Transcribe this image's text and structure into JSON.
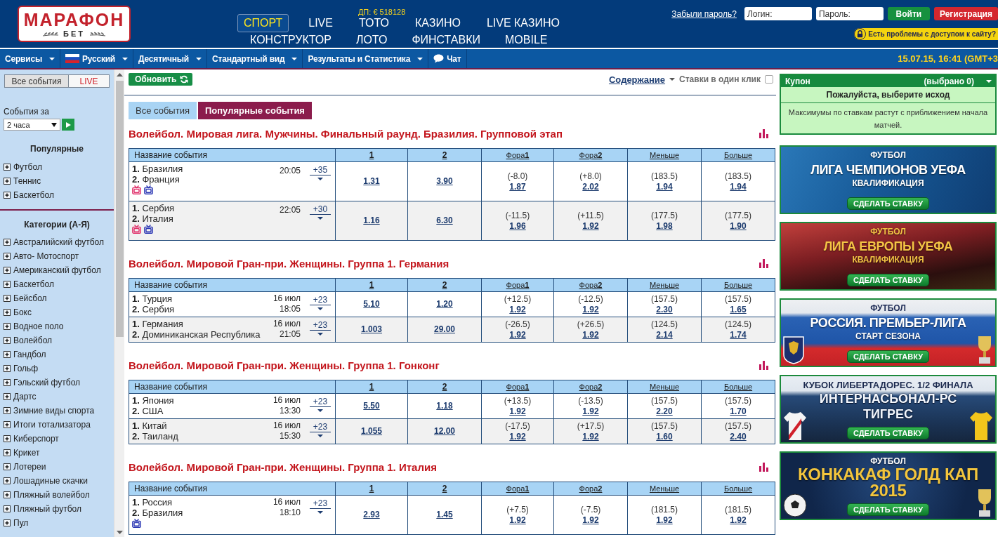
{
  "logo": {
    "title": "МАРАФОН",
    "subtitle": "БЕТ"
  },
  "nav": {
    "rows": [
      {
        "items": [
          {
            "label": "СПОРТ",
            "selected": true
          },
          {
            "label": "LIVE",
            "selected": false
          },
          {
            "label": "ТОТО",
            "selected": false,
            "badge": "ДП: € 518128"
          },
          {
            "label": "КАЗИНО",
            "selected": false
          },
          {
            "label": "LIVE КАЗИНО",
            "selected": false
          }
        ]
      },
      {
        "items": [
          {
            "label": "КОНСТРУКТОР",
            "selected": false
          },
          {
            "label": "ЛОТО",
            "selected": false
          },
          {
            "label": "ФИНСТАВКИ",
            "selected": false
          },
          {
            "label": "MOBILE",
            "selected": false
          }
        ]
      }
    ]
  },
  "account": {
    "forgot_link": "Забыли пароль?",
    "login_placeholder": "Логин:",
    "password_placeholder": "Пароль:",
    "login_button": "Войти",
    "register_button": "Регистрация",
    "access_notice": "Есть проблемы с доступом к сайту?"
  },
  "menu_bar": {
    "items": [
      {
        "label": "Сервисы",
        "kind": "dropdown"
      },
      {
        "label": "Русский",
        "kind": "language"
      },
      {
        "label": "Десятичный",
        "kind": "dropdown"
      },
      {
        "label": "Стандартный вид",
        "kind": "dropdown"
      },
      {
        "label": "Результаты и Статистика",
        "kind": "dropdown"
      },
      {
        "label": "Чат",
        "kind": "chat"
      }
    ],
    "datetime": "15.07.15, 16:41 (GMT+3"
  },
  "sidebar": {
    "tabs": [
      {
        "label": "Все события",
        "kind": "all",
        "selected": true
      },
      {
        "label": "LIVE",
        "kind": "live",
        "selected": false
      }
    ],
    "period": {
      "label": "События за",
      "value": "2 часа"
    },
    "popular": {
      "heading": "Популярные",
      "items": [
        {
          "label": "Футбол",
          "expanded": false
        },
        {
          "label": "Теннис",
          "expanded": false
        },
        {
          "label": "Баскетбол",
          "expanded": false
        }
      ]
    },
    "categories": {
      "heading": "Категории (А-Я)",
      "items": [
        {
          "label": "Австралийский футбол",
          "expanded": false
        },
        {
          "label": "Авто- Мотоспорт",
          "expanded": false
        },
        {
          "label": "Американский футбол",
          "expanded": false
        },
        {
          "label": "Баскетбол",
          "expanded": false
        },
        {
          "label": "Бейсбол",
          "expanded": false
        },
        {
          "label": "Бокс",
          "expanded": false
        },
        {
          "label": "Водное поло",
          "expanded": false
        },
        {
          "label": "Волейбол",
          "expanded": false
        },
        {
          "label": "Гандбол",
          "expanded": false
        },
        {
          "label": "Гольф",
          "expanded": false
        },
        {
          "label": "Гэльский футбол",
          "expanded": false
        },
        {
          "label": "Дартс",
          "expanded": false
        },
        {
          "label": "Зимние виды спорта",
          "expanded": false
        },
        {
          "label": "Итоги тотализатора",
          "expanded": false
        },
        {
          "label": "Киберспорт",
          "expanded": false
        },
        {
          "label": "Крикет",
          "expanded": false
        },
        {
          "label": "Лотереи",
          "expanded": false
        },
        {
          "label": "Лошадиные скачки",
          "expanded": false
        },
        {
          "label": "Пляжный волейбол",
          "expanded": false
        },
        {
          "label": "Пляжный футбол",
          "expanded": false
        },
        {
          "label": "Пул",
          "expanded": false
        }
      ]
    }
  },
  "content": {
    "refresh_button": "Обновить",
    "contents_link": "Содержание",
    "one_click": {
      "label": "Ставки в один клик",
      "checked": false
    },
    "tabs": [
      {
        "label": "Все события",
        "selected": false
      },
      {
        "label": "Популярные события",
        "selected": true
      }
    ],
    "sections": [
      {
        "title": "Волейбол. Мировая лига. Мужчины. Финальный раунд. Бразилия. Групповой этап",
        "columns": [
          {
            "label": "Название события",
            "kind": "name"
          },
          {
            "label": "1",
            "kind": "outcome"
          },
          {
            "label": "2",
            "kind": "outcome"
          },
          {
            "label": "Фора**1**",
            "kind": "market"
          },
          {
            "label": "Фора**2**",
            "kind": "market"
          },
          {
            "label": "Меньше",
            "kind": "market"
          },
          {
            "label": "Больше",
            "kind": "market"
          }
        ],
        "rows": [
          {
            "teams": [
              "**1.** Бразилия",
              "**2.** Франция"
            ],
            "time": "20:05",
            "more": "+35",
            "tv": [
              {
                "color": "#e0306a"
              },
              {
                "color": "#2b37b4"
              }
            ],
            "odds": [
              {
                "price": "1.31"
              },
              {
                "price": "3.90"
              },
              {
                "line": "(-8.0)",
                "price": "1.87"
              },
              {
                "line": "(+8.0)",
                "price": "2.02"
              },
              {
                "line": "(183.5)",
                "price": "1.94"
              },
              {
                "line": "(183.5)",
                "price": "1.94"
              }
            ]
          },
          {
            "teams": [
              "**1.** Сербия",
              "**2.** Италия"
            ],
            "time": "22:05",
            "more": "+30",
            "tv": [
              {
                "color": "#e0306a"
              },
              {
                "color": "#2b37b4"
              }
            ],
            "odds": [
              {
                "price": "1.16"
              },
              {
                "price": "6.30"
              },
              {
                "line": "(-11.5)",
                "price": "1.96"
              },
              {
                "line": "(+11.5)",
                "price": "1.92"
              },
              {
                "line": "(177.5)",
                "price": "1.98"
              },
              {
                "line": "(177.5)",
                "price": "1.90"
              }
            ]
          }
        ]
      },
      {
        "title": "Волейбол. Мировой Гран-при. Женщины. Группа 1. Германия",
        "columns": [
          {
            "label": "Название события",
            "kind": "name"
          },
          {
            "label": "1",
            "kind": "outcome"
          },
          {
            "label": "2",
            "kind": "outcome"
          },
          {
            "label": "Фора**1**",
            "kind": "market"
          },
          {
            "label": "Фора**2**",
            "kind": "market"
          },
          {
            "label": "Меньше",
            "kind": "market"
          },
          {
            "label": "Больше",
            "kind": "market"
          }
        ],
        "rows": [
          {
            "teams": [
              "**1.** Турция",
              "**2.** Сербия"
            ],
            "date": "16 июл",
            "time": "18:05",
            "more": "+23",
            "odds": [
              {
                "price": "5.10"
              },
              {
                "price": "1.20"
              },
              {
                "line": "(+12.5)",
                "price": "1.92"
              },
              {
                "line": "(-12.5)",
                "price": "1.92"
              },
              {
                "line": "(157.5)",
                "price": "2.30"
              },
              {
                "line": "(157.5)",
                "price": "1.65"
              }
            ]
          },
          {
            "teams": [
              "**1.** Германия",
              "**2.** Доминиканская Республика"
            ],
            "date": "16 июл",
            "time": "21:05",
            "more": "+23",
            "odds": [
              {
                "price": "1.003"
              },
              {
                "price": "29.00"
              },
              {
                "line": "(-26.5)",
                "price": "1.92"
              },
              {
                "line": "(+26.5)",
                "price": "1.92"
              },
              {
                "line": "(124.5)",
                "price": "2.14"
              },
              {
                "line": "(124.5)",
                "price": "1.74"
              }
            ]
          }
        ]
      },
      {
        "title": "Волейбол. Мировой Гран-при. Женщины. Группа 1. Гонконг",
        "columns": [
          {
            "label": "Название события",
            "kind": "name"
          },
          {
            "label": "1",
            "kind": "outcome"
          },
          {
            "label": "2",
            "kind": "outcome"
          },
          {
            "label": "Фора**1**",
            "kind": "market"
          },
          {
            "label": "Фора**2**",
            "kind": "market"
          },
          {
            "label": "Меньше",
            "kind": "market"
          },
          {
            "label": "Больше",
            "kind": "market"
          }
        ],
        "rows": [
          {
            "teams": [
              "**1.** Япония",
              "**2.** США"
            ],
            "date": "16 июл",
            "time": "13:30",
            "more": "+23",
            "odds": [
              {
                "price": "5.50"
              },
              {
                "price": "1.18"
              },
              {
                "line": "(+13.5)",
                "price": "1.92"
              },
              {
                "line": "(-13.5)",
                "price": "1.92"
              },
              {
                "line": "(157.5)",
                "price": "2.20"
              },
              {
                "line": "(157.5)",
                "price": "1.70"
              }
            ]
          },
          {
            "teams": [
              "**1.** Китай",
              "**2.** Таиланд"
            ],
            "date": "16 июл",
            "time": "15:30",
            "more": "+23",
            "odds": [
              {
                "price": "1.055"
              },
              {
                "price": "12.00"
              },
              {
                "line": "(-17.5)",
                "price": "1.92"
              },
              {
                "line": "(+17.5)",
                "price": "1.92"
              },
              {
                "line": "(157.5)",
                "price": "1.60"
              },
              {
                "line": "(157.5)",
                "price": "2.40"
              }
            ]
          }
        ]
      },
      {
        "title": "Волейбол. Мировой Гран-при. Женщины. Группа 1. Италия",
        "columns": [
          {
            "label": "Название события",
            "kind": "name"
          },
          {
            "label": "1",
            "kind": "outcome"
          },
          {
            "label": "2",
            "kind": "outcome"
          },
          {
            "label": "Фора**1**",
            "kind": "market"
          },
          {
            "label": "Фора**2**",
            "kind": "market"
          },
          {
            "label": "Меньше",
            "kind": "market"
          },
          {
            "label": "Больше",
            "kind": "market"
          }
        ],
        "rows": [
          {
            "teams": [
              "**1.** Россия",
              "**2.** Бразилия"
            ],
            "date": "16 июл",
            "time": "18:10",
            "more": "+23",
            "tv": [
              {
                "color": "#2b37b4"
              }
            ],
            "odds": [
              {
                "price": "2.93"
              },
              {
                "price": "1.45"
              },
              {
                "line": "(+7.5)",
                "price": "1.92"
              },
              {
                "line": "(-7.5)",
                "price": "1.92"
              },
              {
                "line": "(181.5)",
                "price": "1.92"
              },
              {
                "line": "(181.5)",
                "price": "1.92"
              }
            ]
          }
        ]
      }
    ]
  },
  "coupon": {
    "title": "Купон",
    "count": "(выбрано 0)",
    "prompt": "Пожалуйста, выберите исход",
    "note": "Максимумы по ставкам растут с приближением начала матчей."
  },
  "banners": [
    {
      "kind": "champions",
      "lines": [
        {
          "kind": "category",
          "text": "ФУТБОЛ"
        },
        {
          "kind": "title",
          "text": "ЛИГА ЧЕМПИОНОВ УЕФА"
        },
        {
          "kind": "subtitle",
          "text": "КВАЛИФИКАЦИЯ"
        }
      ],
      "button": "СДЕЛАТЬ СТАВКУ"
    },
    {
      "kind": "europa",
      "lines": [
        {
          "kind": "category",
          "text": "ФУТБОЛ"
        },
        {
          "kind": "title",
          "text": "ЛИГА ЕВРОПЫ УЕФА"
        },
        {
          "kind": "subtitle",
          "text": "КВАЛИФИКАЦИЯ"
        }
      ],
      "button": "СДЕЛАТЬ СТАВКУ"
    },
    {
      "kind": "russia",
      "lines": [
        {
          "kind": "category",
          "text": "ФУТБОЛ"
        },
        {
          "kind": "title",
          "text": "РОССИЯ. ПРЕМЬЕР-ЛИГА"
        },
        {
          "kind": "subtitle",
          "text": "СТАРТ СЕЗОНА"
        }
      ],
      "button": "СДЕЛАТЬ СТАВКУ"
    },
    {
      "kind": "libertadores",
      "lines": [
        {
          "kind": "heading",
          "text": "КУБОК ЛИБЕРТАДОРЕС. 1/2 ФИНАЛА"
        },
        {
          "kind": "outline",
          "text": "ИНТЕРНАСЬОНАЛ-РС"
        },
        {
          "kind": "outline",
          "text": "ТИГРЕС"
        }
      ],
      "button": "СДЕЛАТЬ СТАВКУ"
    },
    {
      "kind": "goldcup",
      "lines": [
        {
          "kind": "category",
          "text": "ФУТБОЛ"
        },
        {
          "kind": "large",
          "text": "КОНКАКАФ ГОЛД КАП"
        },
        {
          "kind": "large",
          "text": "2015"
        }
      ],
      "button": "СДЕЛАТЬ СТАВКУ"
    }
  ]
}
